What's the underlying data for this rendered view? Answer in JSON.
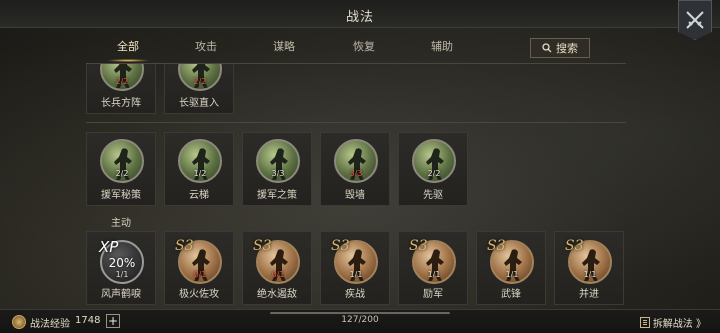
{
  "header": {
    "title": "战法"
  },
  "tabs": [
    {
      "label": "全部",
      "active": true
    },
    {
      "label": "攻击",
      "active": false
    },
    {
      "label": "谋略",
      "active": false
    },
    {
      "label": "恢复",
      "active": false
    },
    {
      "label": "辅助",
      "active": false
    }
  ],
  "search": {
    "label": "搜索",
    "icon": "search-icon"
  },
  "row_top": [
    {
      "name": "长兵方阵",
      "count": "2/2",
      "count_color": "red",
      "style": "green"
    },
    {
      "name": "长驱直入",
      "count": "2/2",
      "count_color": "red",
      "style": "green"
    }
  ],
  "row_mid": [
    {
      "name": "援军秘策",
      "count": "2/2",
      "count_color": "white",
      "style": "green"
    },
    {
      "name": "云梯",
      "count": "1/2",
      "count_color": "white",
      "style": "green"
    },
    {
      "name": "援军之策",
      "count": "3/3",
      "count_color": "white",
      "style": "green"
    },
    {
      "name": "毁墙",
      "count": "3/3",
      "count_color": "red",
      "style": "green"
    },
    {
      "name": "先驱",
      "count": "2/2",
      "count_color": "white",
      "style": "green"
    }
  ],
  "section_label": "主动",
  "row_bottom": [
    {
      "name": "风声鹤唳",
      "count": "1/1",
      "count_color": "white",
      "style": "dark",
      "xp": "XP",
      "percent": "20%"
    },
    {
      "name": "极火佐攻",
      "count": "0/1",
      "count_color": "red",
      "style": "gold",
      "grade": "S3"
    },
    {
      "name": "绝水遏敌",
      "count": "0/1",
      "count_color": "red",
      "style": "gold",
      "grade": "S3"
    },
    {
      "name": "疾战",
      "count": "1/1",
      "count_color": "white",
      "style": "gold",
      "grade": "S3"
    },
    {
      "name": "励军",
      "count": "1/1",
      "count_color": "white",
      "style": "gold",
      "grade": "S3"
    },
    {
      "name": "武锋",
      "count": "1/1",
      "count_color": "white",
      "style": "gold",
      "grade": "S3"
    },
    {
      "name": "并进",
      "count": "1/1",
      "count_color": "white",
      "style": "gold",
      "grade": "S3"
    }
  ],
  "footer": {
    "exp_label": "战法经验",
    "exp_value": "1748",
    "plus": "+",
    "progress": "127/200",
    "dismantle": "拆解战法 》"
  }
}
